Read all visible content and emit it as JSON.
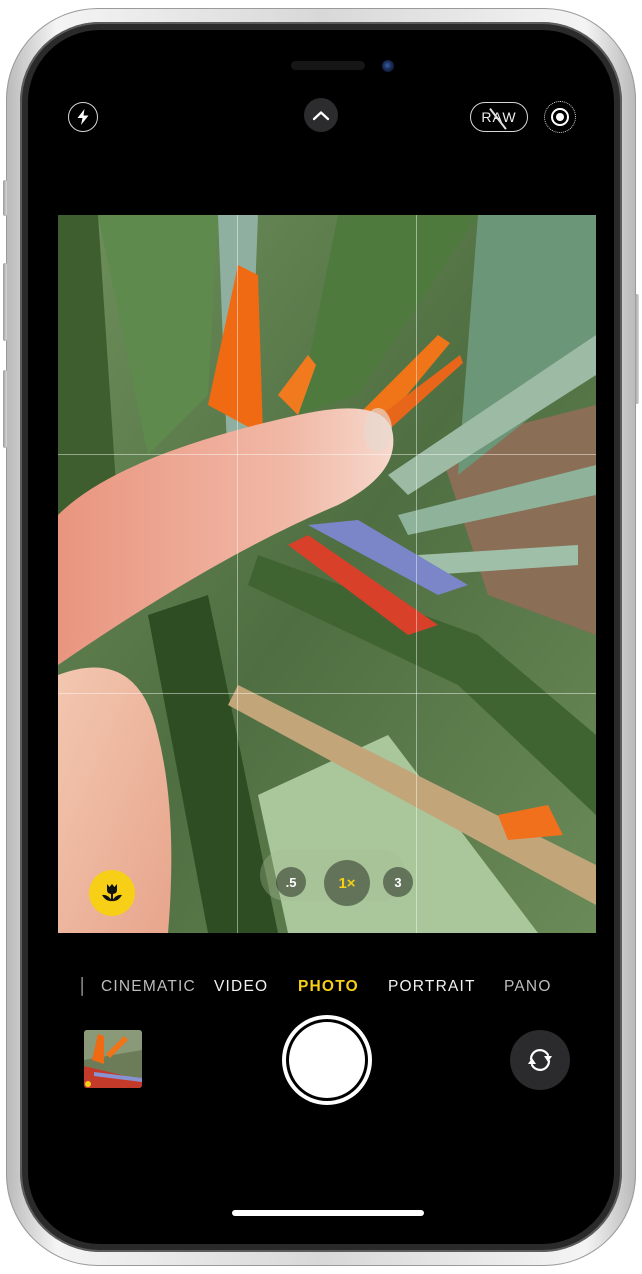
{
  "app": "Camera",
  "top_bar": {
    "flash_icon": "bolt-icon",
    "controls_toggle_icon": "chevron-up-icon",
    "raw_label": "RAW",
    "raw_state": "off",
    "live_photo_icon": "live-photo-icon"
  },
  "viewfinder": {
    "grid": "3x3",
    "macro_icon": "tulip-icon",
    "macro_color": "#f7cf16",
    "zoom_options": [
      {
        "label": ".5",
        "active": false
      },
      {
        "label": "1×",
        "active": true
      },
      {
        "label": "3",
        "active": false
      }
    ]
  },
  "modes": {
    "items": [
      {
        "label": "CINEMATIC",
        "active": false
      },
      {
        "label": "VIDEO",
        "active": false
      },
      {
        "label": "PHOTO",
        "active": true
      },
      {
        "label": "PORTRAIT",
        "active": false
      },
      {
        "label": "PANO",
        "active": false
      }
    ],
    "active_color": "#f7cf16"
  },
  "bottom_bar": {
    "thumbnail_icon": "last-photo-thumbnail",
    "shutter_icon": "shutter-button",
    "flip_icon": "camera-flip-icon"
  }
}
